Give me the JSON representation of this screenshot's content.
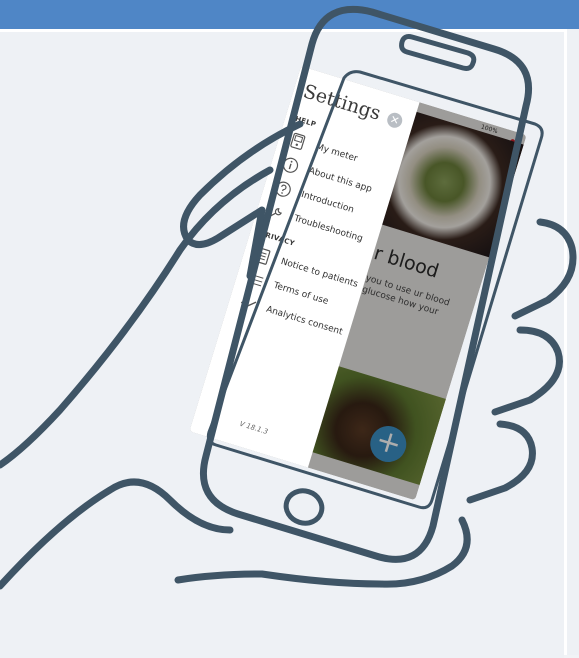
{
  "drawer": {
    "title": "Settings",
    "close_icon": "close-icon",
    "sections": {
      "help": "HELP",
      "privacy": "PRIVACY"
    },
    "help_items": [
      {
        "label": "My meter",
        "icon": "meter-icon"
      },
      {
        "label": "About this app",
        "icon": "info-icon"
      },
      {
        "label": "Introduction",
        "icon": "help-circle-icon"
      },
      {
        "label": "Troubleshooting",
        "icon": "wrench-icon"
      }
    ],
    "privacy_items": [
      {
        "label": "Notice to patients",
        "icon": "document-icon"
      },
      {
        "label": "Terms of use",
        "icon": "list-icon"
      },
      {
        "label": "Analytics consent",
        "icon": "checkmark-icon"
      }
    ],
    "version": "V 18.1.3"
  },
  "background": {
    "status": "100%",
    "card_title": "r blood",
    "card_text": "you to use ur blood glucose how your",
    "fab": "+"
  },
  "colors": {
    "topbar": "#4f86c6",
    "line_art": "#3f5566",
    "fab": "#3b8fc4"
  }
}
